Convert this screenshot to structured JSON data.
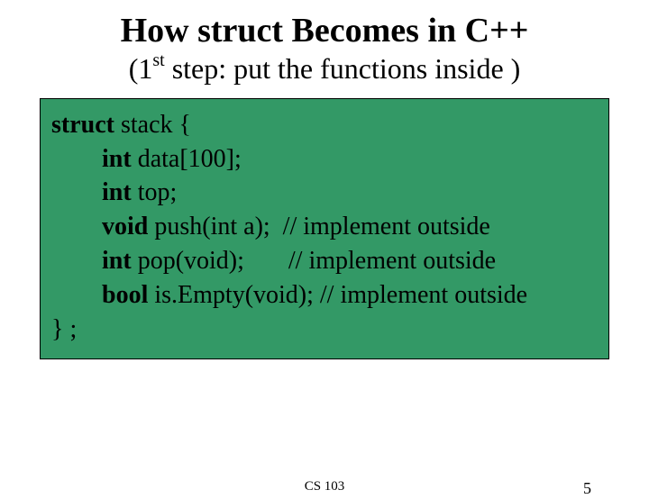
{
  "title": "How struct Becomes in C++",
  "subtitle_prefix": "(1",
  "subtitle_super": "st",
  "subtitle_rest": " step: put the functions inside )",
  "code": {
    "l1_kw": "struct",
    "l1_rest": " stack {",
    "l2_kw": "int",
    "l2_rest": " data[100];",
    "l3_kw": "int",
    "l3_rest": " top;",
    "l4_kw": "void",
    "l4_rest": " push(int a);  // implement outside",
    "l5_kw": "int",
    "l5_rest": " pop(void);       // implement outside",
    "l6_kw": "bool",
    "l6_rest": " is.Empty(void); // implement outside",
    "l7": "} ;"
  },
  "footer_center": "CS 103",
  "footer_page": "5"
}
